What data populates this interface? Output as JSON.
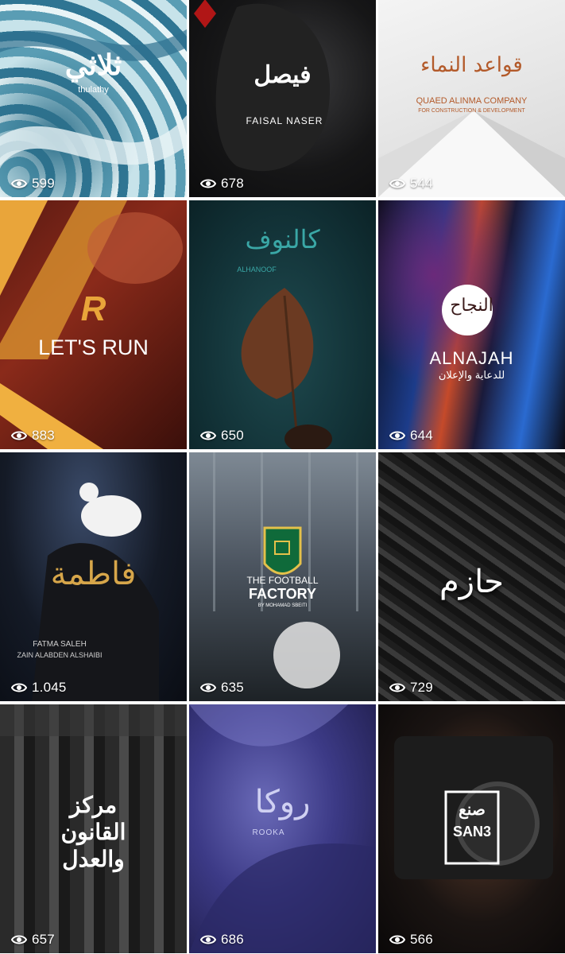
{
  "gallery": {
    "items": [
      {
        "logo": "ثلاثي",
        "subtitle": "thulathy",
        "views": "599"
      },
      {
        "logo": "فيصل",
        "subtitle": "FAISAL NASER",
        "views": "678"
      },
      {
        "logo": "قواعد النماء",
        "subtitle": "QUAED ALINMA COMPANY",
        "subtitle2": "FOR CONSTRUCTION & DEVELOPMENT",
        "views": "544"
      },
      {
        "logo": "R",
        "subtitle": "LET'S RUN",
        "views": "883"
      },
      {
        "logo": "كالنوف",
        "subtitle": "ALHANOOF",
        "views": "650"
      },
      {
        "logo": "النجاح",
        "subtitle": "ALNAJAH",
        "subtitle2": "للدعاية والإعلان",
        "views": "644"
      },
      {
        "logo": "فاطمة",
        "subtitle": "FATMA SALEH",
        "subtitle2": "ZAIN ALABDEN ALSHAIBI",
        "views": "1.045"
      },
      {
        "logo": "THE FOOTBALL",
        "subtitle": "FACTORY",
        "subtitle2": "BY MOHAMAD SBEITI",
        "views": "635"
      },
      {
        "logo": "حازم",
        "subtitle": "",
        "views": "729"
      },
      {
        "logo": "مركز القانون والعدل",
        "subtitle": "",
        "views": "657"
      },
      {
        "logo": "روكا",
        "subtitle": "ROOKA",
        "views": "686"
      },
      {
        "logo": "صنع",
        "subtitle": "SAN3",
        "views": "566"
      }
    ]
  },
  "icons": {
    "views": "eye-icon"
  },
  "colors": {
    "gold": "#d7a64a",
    "teal_text": "#3aa7a6",
    "white": "#ffffff"
  }
}
